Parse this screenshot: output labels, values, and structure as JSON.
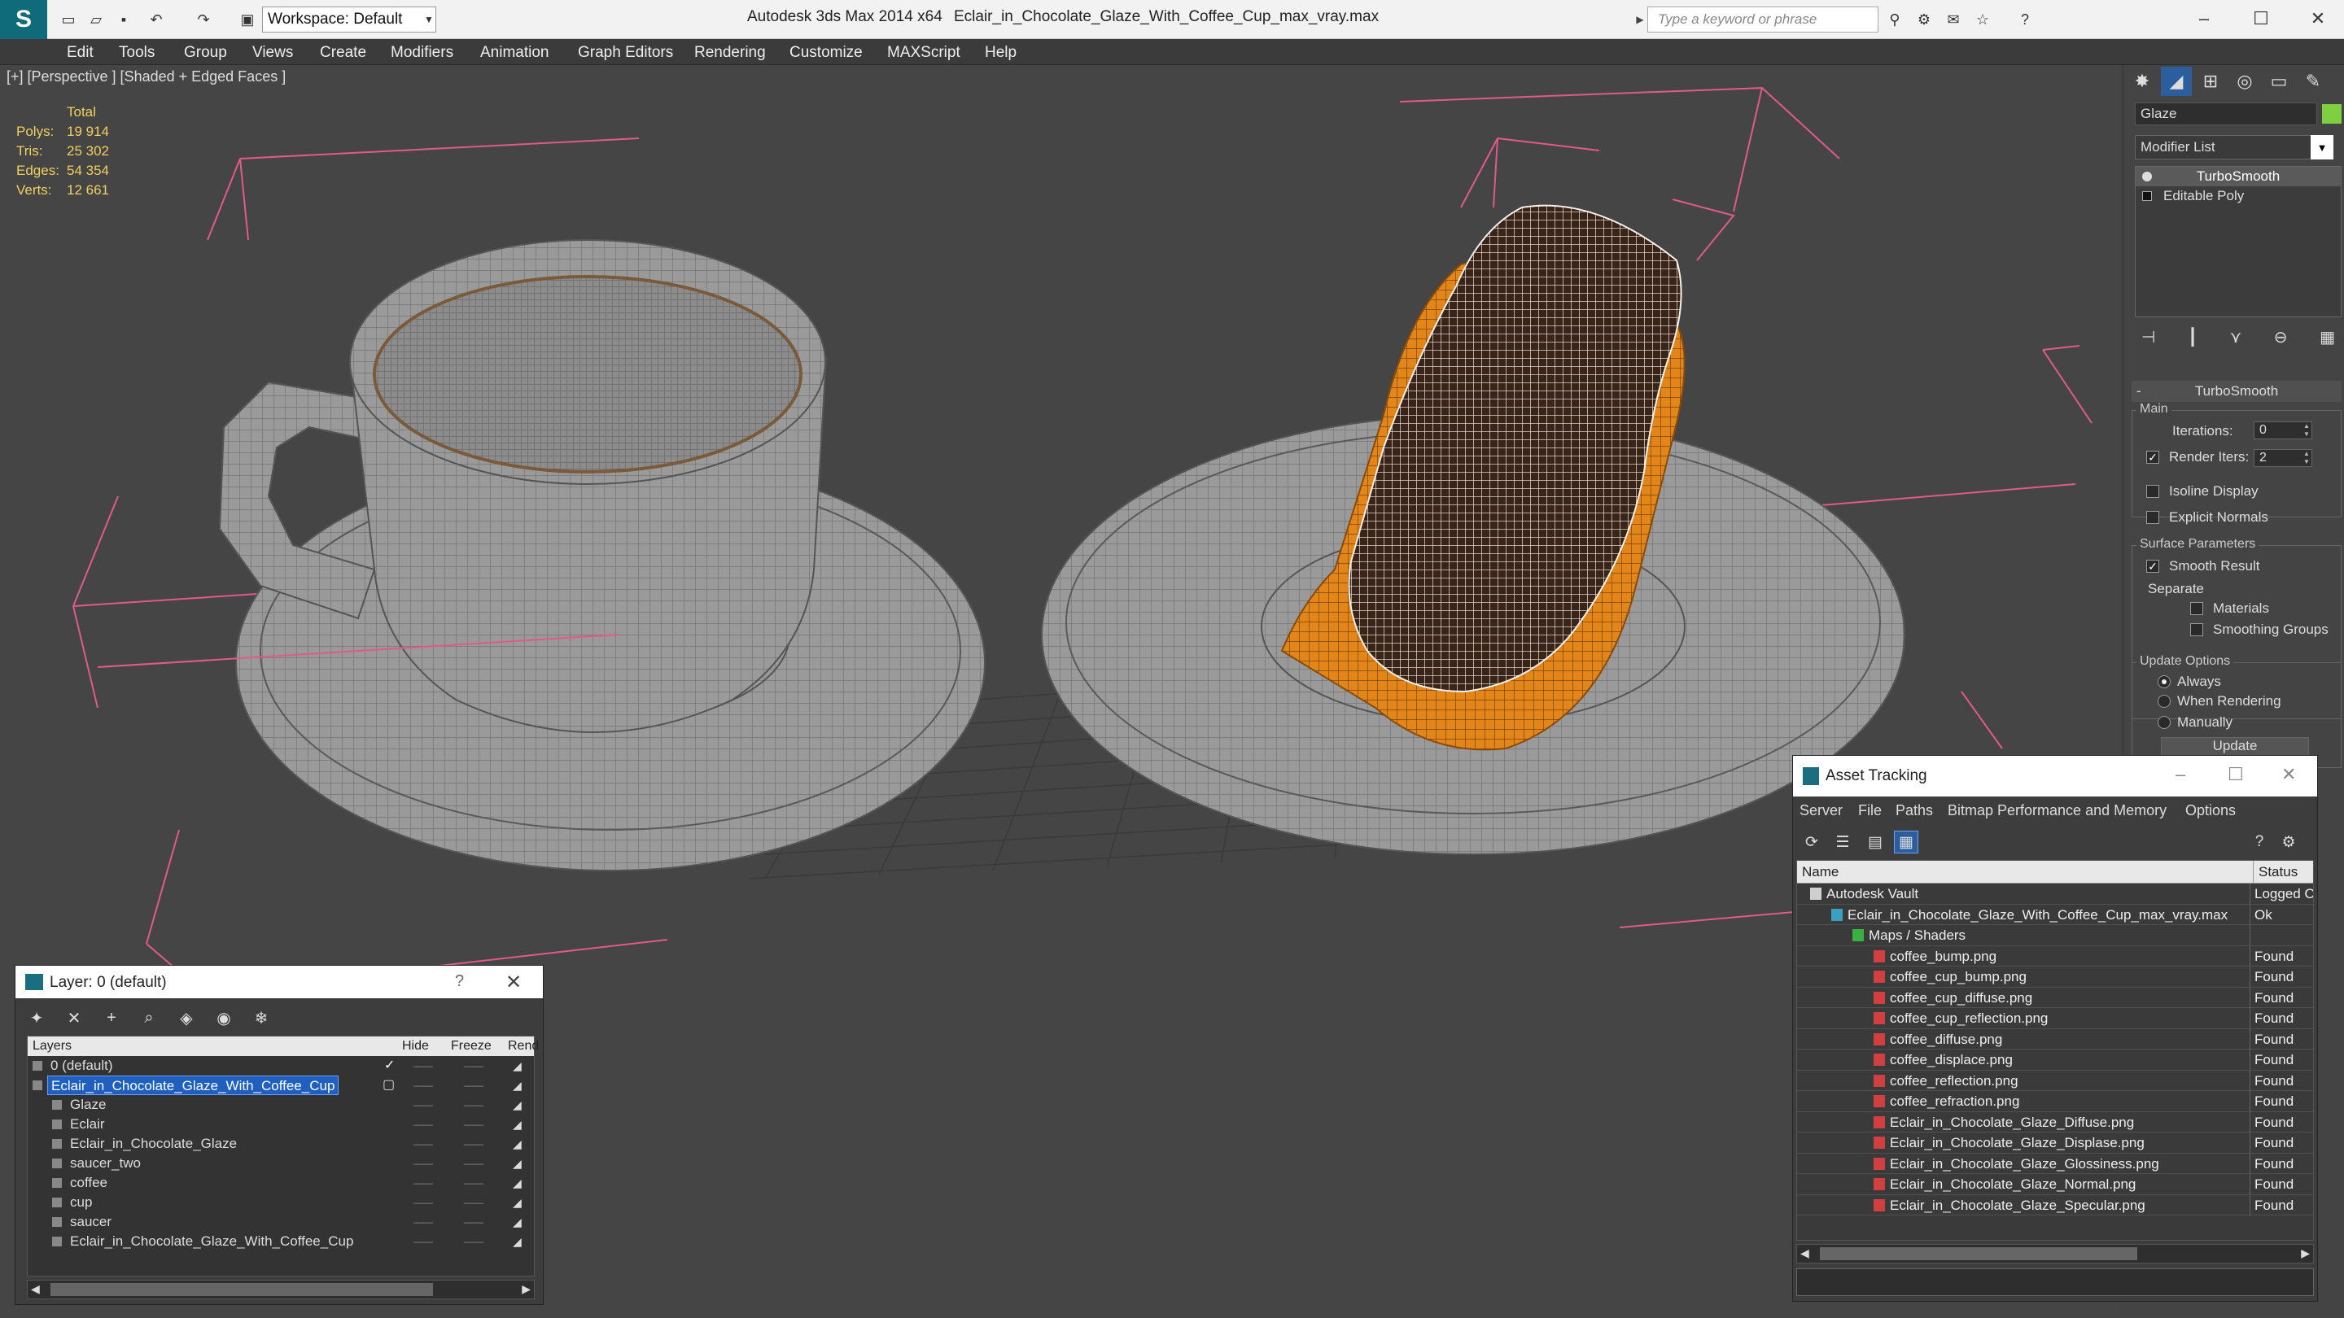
{
  "titlebar": {
    "workspace": "Workspace: Default",
    "app_title": "Autodesk 3ds Max  2014 x64",
    "file_title": "Eclair_in_Chocolate_Glaze_With_Coffee_Cup_max_vray.max",
    "search_placeholder": "Type a keyword or phrase"
  },
  "menu": [
    "Edit",
    "Tools",
    "Group",
    "Views",
    "Create",
    "Modifiers",
    "Animation",
    "Graph Editors",
    "Rendering",
    "Customize",
    "MAXScript",
    "Help"
  ],
  "viewport": {
    "label": "[+] [Perspective ] [Shaded + Edged Faces ]",
    "stats": {
      "header": "Total",
      "rows": [
        {
          "k": "Polys:",
          "v": "19 914"
        },
        {
          "k": "Tris:",
          "v": "25 302"
        },
        {
          "k": "Edges:",
          "v": "54 354"
        },
        {
          "k": "Verts:",
          "v": "12 661"
        }
      ]
    }
  },
  "command_panel": {
    "object_name": "Glaze",
    "object_color": "#7ed040",
    "modifier_list": "Modifier List",
    "stack": [
      "TurboSmooth",
      "Editable Poly"
    ],
    "rollout_title": "TurboSmooth",
    "main_label": "Main",
    "iterations_label": "Iterations:",
    "iterations_value": "0",
    "render_iters_label": "Render Iters:",
    "render_iters_value": "2",
    "isoline_label": "Isoline Display",
    "explicit_label": "Explicit Normals",
    "surface_label": "Surface Parameters",
    "smooth_label": "Smooth Result",
    "separate_label": "Separate",
    "materials_label": "Materials",
    "smoothing_groups_label": "Smoothing Groups",
    "update_options_label": "Update Options",
    "always_label": "Always",
    "when_rendering_label": "When Rendering",
    "manually_label": "Manually",
    "update_button": "Update"
  },
  "layer_window": {
    "title": "Layer: 0 (default)",
    "help": "?",
    "columns": {
      "layers": "Layers",
      "hide": "Hide",
      "freeze": "Freeze",
      "render": "Rend"
    },
    "rows": [
      {
        "name": "0 (default)",
        "indent": 1
      },
      {
        "name": "Eclair_in_Chocolate_Glaze_With_Coffee_Cup",
        "indent": 1,
        "selected": true
      },
      {
        "name": "Glaze",
        "indent": 2
      },
      {
        "name": "Eclair",
        "indent": 2
      },
      {
        "name": "Eclair_in_Chocolate_Glaze",
        "indent": 2
      },
      {
        "name": "saucer_two",
        "indent": 2
      },
      {
        "name": "coffee",
        "indent": 2
      },
      {
        "name": "cup",
        "indent": 2
      },
      {
        "name": "saucer",
        "indent": 2
      },
      {
        "name": "Eclair_in_Chocolate_Glaze_With_Coffee_Cup",
        "indent": 2
      }
    ]
  },
  "asset_window": {
    "title": "Asset Tracking",
    "menu": [
      "Server",
      "File",
      "Paths",
      "Bitmap Performance and Memory",
      "Options"
    ],
    "columns": {
      "name": "Name",
      "status": "Status"
    },
    "rows": [
      {
        "name": "Autodesk Vault",
        "status": "Logged O",
        "indent": 1,
        "icon": "vault"
      },
      {
        "name": "Eclair_in_Chocolate_Glaze_With_Coffee_Cup_max_vray.max",
        "status": "Ok",
        "indent": 2,
        "icon": "max"
      },
      {
        "name": "Maps / Shaders",
        "status": "",
        "indent": 3,
        "icon": "maps"
      },
      {
        "name": "coffee_bump.png",
        "status": "Found",
        "indent": 4,
        "icon": "png"
      },
      {
        "name": "coffee_cup_bump.png",
        "status": "Found",
        "indent": 4,
        "icon": "png"
      },
      {
        "name": "coffee_cup_diffuse.png",
        "status": "Found",
        "indent": 4,
        "icon": "png"
      },
      {
        "name": "coffee_cup_reflection.png",
        "status": "Found",
        "indent": 4,
        "icon": "png"
      },
      {
        "name": "coffee_diffuse.png",
        "status": "Found",
        "indent": 4,
        "icon": "png"
      },
      {
        "name": "coffee_displace.png",
        "status": "Found",
        "indent": 4,
        "icon": "png"
      },
      {
        "name": "coffee_reflection.png",
        "status": "Found",
        "indent": 4,
        "icon": "png"
      },
      {
        "name": "coffee_refraction.png",
        "status": "Found",
        "indent": 4,
        "icon": "png"
      },
      {
        "name": "Eclair_in_Chocolate_Glaze_Diffuse.png",
        "status": "Found",
        "indent": 4,
        "icon": "png"
      },
      {
        "name": "Eclair_in_Chocolate_Glaze_Displase.png",
        "status": "Found",
        "indent": 4,
        "icon": "png"
      },
      {
        "name": "Eclair_in_Chocolate_Glaze_Glossiness.png",
        "status": "Found",
        "indent": 4,
        "icon": "png"
      },
      {
        "name": "Eclair_in_Chocolate_Glaze_Normal.png",
        "status": "Found",
        "indent": 4,
        "icon": "png"
      },
      {
        "name": "Eclair_in_Chocolate_Glaze_Specular.png",
        "status": "Found",
        "indent": 4,
        "icon": "png"
      }
    ]
  }
}
